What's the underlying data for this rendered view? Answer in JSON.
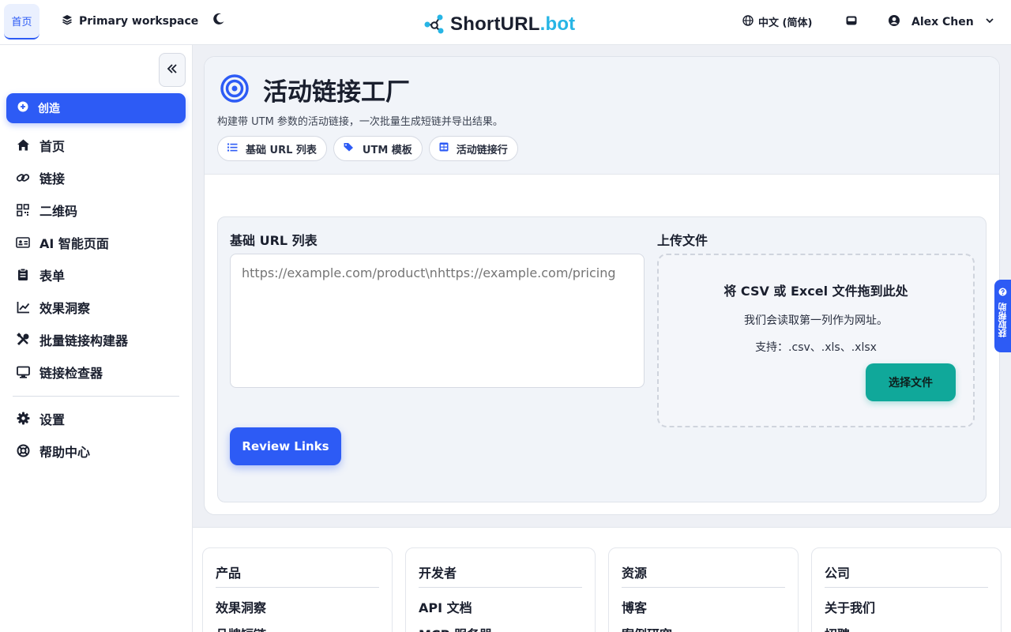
{
  "header": {
    "home_tab": "首页",
    "workspace": "Primary workspace",
    "brand_main": "ShortURL",
    "brand_tld": ".bot",
    "language": "中文 (简体)",
    "user_name": "Alex Chen"
  },
  "sidebar": {
    "create_label": "创造",
    "items": [
      {
        "label": "首页",
        "icon": "home-icon"
      },
      {
        "label": "链接",
        "icon": "link-icon"
      },
      {
        "label": "二维码",
        "icon": "qr-code-icon"
      },
      {
        "label": "AI 智能页面",
        "icon": "id-card-icon"
      },
      {
        "label": "表单",
        "icon": "clipboard-icon"
      },
      {
        "label": "效果洞察",
        "icon": "line-chart-icon"
      },
      {
        "label": "批量链接构建器",
        "icon": "tools-icon"
      },
      {
        "label": "链接检查器",
        "icon": "monitor-icon"
      }
    ],
    "secondary": [
      {
        "label": "设置",
        "icon": "gear-icon"
      },
      {
        "label": "帮助中心",
        "icon": "lifebuoy-icon"
      }
    ]
  },
  "main": {
    "title": "活动链接工厂",
    "subtitle": "构建带 UTM 参数的活动链接，一次批量生成短链并导出结果。",
    "chips": [
      {
        "label": "基础 URL 列表",
        "icon": "list-icon"
      },
      {
        "label": "UTM 模板",
        "icon": "tags-icon"
      },
      {
        "label": "活动链接行",
        "icon": "table-icon"
      }
    ],
    "base_url_label": "基础 URL 列表",
    "base_url_placeholder": "https://example.com/product\\nhttps://example.com/pricing",
    "review_button": "Review Links",
    "upload_label": "上传文件",
    "dropzone_title": "将 CSV 或 Excel 文件拖到此处",
    "dropzone_desc": "我们会读取第一列作为网址。",
    "dropzone_support": "支持：.csv、.xls、.xlsx",
    "choose_file": "选择文件"
  },
  "help_tab": "获取帮助",
  "footer": {
    "columns": [
      {
        "title": "产品",
        "links": [
          "效果洞察",
          "品牌短链"
        ]
      },
      {
        "title": "开发者",
        "links": [
          "API 文档",
          "MCP 服务器"
        ]
      },
      {
        "title": "资源",
        "links": [
          "博客",
          "案例研究"
        ]
      },
      {
        "title": "公司",
        "links": [
          "关于我们",
          "招聘"
        ]
      }
    ]
  },
  "colors": {
    "accent": "#2d5bf5",
    "brand_tld": "#27b5e5",
    "teal": "#10a89a"
  }
}
